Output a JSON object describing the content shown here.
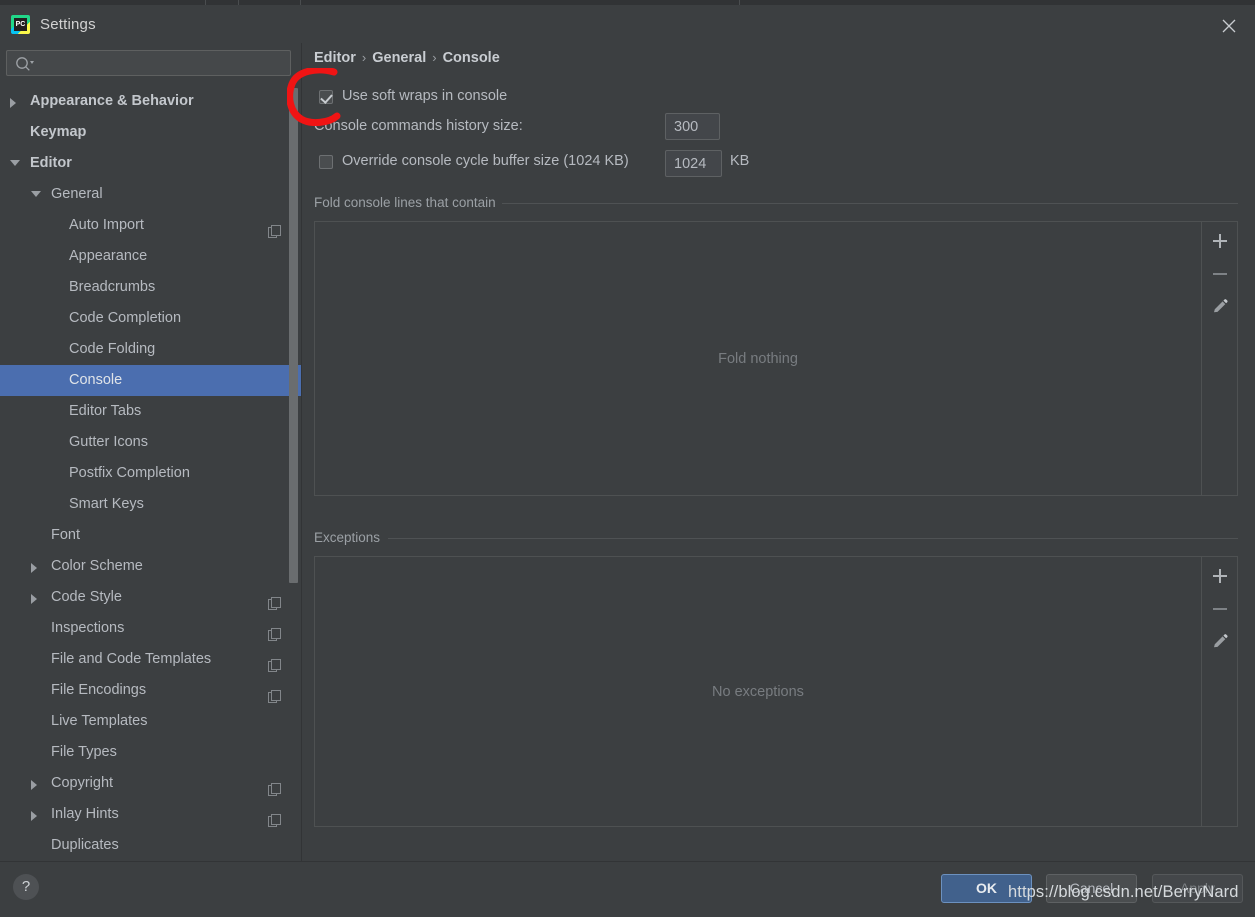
{
  "window": {
    "title": "Settings",
    "app_icon": "pycharm-icon",
    "close_icon": "close-icon"
  },
  "search": {
    "value": "",
    "placeholder": "",
    "icon": "search-icon"
  },
  "sidebar": {
    "items": [
      {
        "label": "Appearance & Behavior",
        "indent": 30,
        "arrow": "collapsed",
        "bold": true,
        "copy": false,
        "selected": false
      },
      {
        "label": "Keymap",
        "indent": 30,
        "arrow": "none",
        "bold": true,
        "copy": false,
        "selected": false
      },
      {
        "label": "Editor",
        "indent": 30,
        "arrow": "expanded",
        "bold": true,
        "copy": false,
        "selected": false
      },
      {
        "label": "General",
        "indent": 51,
        "arrow": "expanded",
        "bold": false,
        "copy": false,
        "selected": false
      },
      {
        "label": "Auto Import",
        "indent": 69,
        "arrow": "none",
        "bold": false,
        "copy": true,
        "selected": false
      },
      {
        "label": "Appearance",
        "indent": 69,
        "arrow": "none",
        "bold": false,
        "copy": false,
        "selected": false
      },
      {
        "label": "Breadcrumbs",
        "indent": 69,
        "arrow": "none",
        "bold": false,
        "copy": false,
        "selected": false
      },
      {
        "label": "Code Completion",
        "indent": 69,
        "arrow": "none",
        "bold": false,
        "copy": false,
        "selected": false
      },
      {
        "label": "Code Folding",
        "indent": 69,
        "arrow": "none",
        "bold": false,
        "copy": false,
        "selected": false
      },
      {
        "label": "Console",
        "indent": 69,
        "arrow": "none",
        "bold": false,
        "copy": false,
        "selected": true
      },
      {
        "label": "Editor Tabs",
        "indent": 69,
        "arrow": "none",
        "bold": false,
        "copy": false,
        "selected": false
      },
      {
        "label": "Gutter Icons",
        "indent": 69,
        "arrow": "none",
        "bold": false,
        "copy": false,
        "selected": false
      },
      {
        "label": "Postfix Completion",
        "indent": 69,
        "arrow": "none",
        "bold": false,
        "copy": false,
        "selected": false
      },
      {
        "label": "Smart Keys",
        "indent": 69,
        "arrow": "none",
        "bold": false,
        "copy": false,
        "selected": false
      },
      {
        "label": "Font",
        "indent": 51,
        "arrow": "none",
        "bold": false,
        "copy": false,
        "selected": false
      },
      {
        "label": "Color Scheme",
        "indent": 51,
        "arrow": "collapsed",
        "bold": false,
        "copy": false,
        "selected": false
      },
      {
        "label": "Code Style",
        "indent": 51,
        "arrow": "collapsed",
        "bold": false,
        "copy": true,
        "selected": false
      },
      {
        "label": "Inspections",
        "indent": 51,
        "arrow": "none",
        "bold": false,
        "copy": true,
        "selected": false
      },
      {
        "label": "File and Code Templates",
        "indent": 51,
        "arrow": "none",
        "bold": false,
        "copy": true,
        "selected": false
      },
      {
        "label": "File Encodings",
        "indent": 51,
        "arrow": "none",
        "bold": false,
        "copy": true,
        "selected": false
      },
      {
        "label": "Live Templates",
        "indent": 51,
        "arrow": "none",
        "bold": false,
        "copy": false,
        "selected": false
      },
      {
        "label": "File Types",
        "indent": 51,
        "arrow": "none",
        "bold": false,
        "copy": false,
        "selected": false
      },
      {
        "label": "Copyright",
        "indent": 51,
        "arrow": "collapsed",
        "bold": false,
        "copy": true,
        "selected": false
      },
      {
        "label": "Inlay Hints",
        "indent": 51,
        "arrow": "collapsed",
        "bold": false,
        "copy": true,
        "selected": false
      },
      {
        "label": "Duplicates",
        "indent": 51,
        "arrow": "none",
        "bold": false,
        "copy": false,
        "selected": false
      }
    ]
  },
  "breadcrumb": {
    "part1": "Editor",
    "sep1": "›",
    "part2": "General",
    "sep2": "›",
    "part3": "Console"
  },
  "options": {
    "soft_wraps_label": "Use soft wraps in console",
    "soft_wraps_checked": true,
    "history_label": "Console commands history size:",
    "history_value": "300",
    "override_label": "Override console cycle buffer size (1024 KB)",
    "override_checked": false,
    "override_value": "1024",
    "override_unit": "KB"
  },
  "fold_section": {
    "title": "Fold console lines that contain",
    "empty_text": "Fold nothing",
    "add_icon": "plus-icon",
    "remove_icon": "minus-icon",
    "edit_icon": "pencil-icon"
  },
  "exceptions_section": {
    "title": "Exceptions",
    "empty_text": "No exceptions",
    "add_icon": "plus-icon",
    "remove_icon": "minus-icon",
    "edit_icon": "pencil-icon"
  },
  "footer": {
    "help_label": "?",
    "ok_label": "OK",
    "cancel_label": "Cancel",
    "apply_label": "Apply"
  },
  "watermark": {
    "text": "https://blog.csdn.net/BerryNard"
  },
  "colors": {
    "window_bg": "#3c3f41",
    "selection_blue": "#4b6eaf",
    "primary_button": "#41618c",
    "text": "#b6bac0",
    "annotation_red": "#f01414"
  }
}
